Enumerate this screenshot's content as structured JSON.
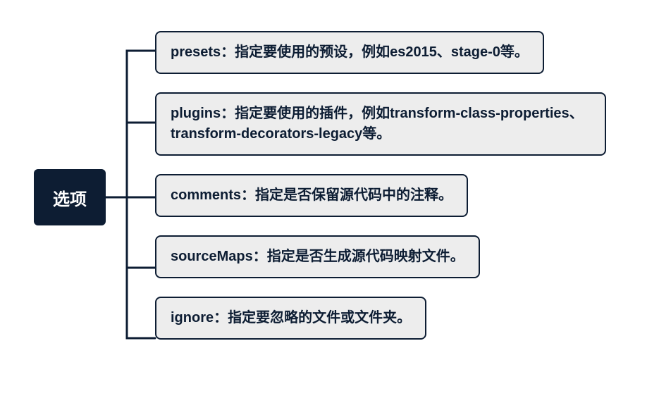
{
  "root": {
    "label": "选项"
  },
  "children": [
    {
      "text": "presets：指定要使用的预设，例如es2015、stage-0等。"
    },
    {
      "text": "plugins：指定要使用的插件，例如transform-class-properties、transform-decorators-legacy等。"
    },
    {
      "text": "comments：指定是否保留源代码中的注释。"
    },
    {
      "text": "sourceMaps：指定是否生成源代码映射文件。"
    },
    {
      "text": "ignore：指定要忽略的文件或文件夹。"
    }
  ],
  "chart_data": {
    "type": "tree",
    "root": "选项",
    "branches": [
      "presets：指定要使用的预设，例如es2015、stage-0等。",
      "plugins：指定要使用的插件，例如transform-class-properties、transform-decorators-legacy等。",
      "comments：指定是否保留源代码中的注释。",
      "sourceMaps：指定是否生成源代码映射文件。",
      "ignore：指定要忽略的文件或文件夹。"
    ]
  }
}
